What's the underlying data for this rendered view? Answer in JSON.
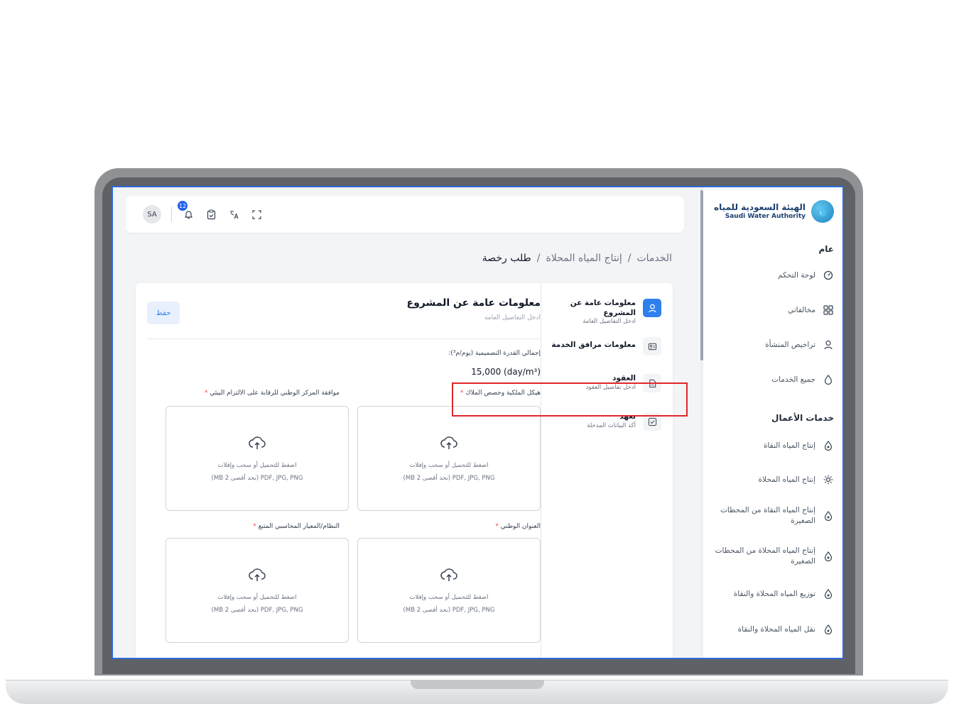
{
  "brand": {
    "name_ar": "الهيئة السعودية للمياه",
    "name_en": "Saudi Water Authority"
  },
  "sidebar": {
    "section_general": "عام",
    "general_items": [
      {
        "label": "لوحة التحكم",
        "icon": "gauge-icon"
      },
      {
        "label": "مخالفاتي",
        "icon": "grid-icon"
      },
      {
        "label": "تراخيص المنشأة",
        "icon": "user-icon"
      },
      {
        "label": "جميع الخدمات",
        "icon": "drop-icon"
      }
    ],
    "section_business": "خدمات الأعمال",
    "business_items": [
      {
        "label": "إنتاج المياه النقاة",
        "icon": "drop-icon"
      },
      {
        "label": "إنتاج المياه المحلاة",
        "icon": "sun-icon"
      },
      {
        "label": "إنتاج المياه النقاة من المحطات الصغيرة",
        "icon": "drop-icon"
      },
      {
        "label": "إنتاج المياه المحلاة من المحطات الصغيرة",
        "icon": "drop-icon"
      },
      {
        "label": "توزيع المياه المحلاة والنقاة",
        "icon": "drop-icon"
      },
      {
        "label": "نقل المياه المحلاة والنقاة",
        "icon": "drop-icon"
      }
    ]
  },
  "topbar": {
    "avatar": "SA",
    "notification_count": "12"
  },
  "breadcrumb": {
    "root": "الخدمات",
    "sep": "/",
    "middle": "إنتاج المياه المحلاة",
    "current": "طلب رخصة"
  },
  "steps": [
    {
      "title": "معلومات عامة عن المشروع",
      "sub": "ادخل التفاصيل العامة",
      "icon": "user-icon",
      "active": true
    },
    {
      "title": "معلومات مرافق الخدمة",
      "sub": "",
      "icon": "id-card-icon",
      "active": false
    },
    {
      "title": "العقود",
      "sub": "ادخل تفاصيل العقود",
      "icon": "document-icon",
      "active": false
    },
    {
      "title": "تعهد",
      "sub": "أكد البيانات المدخلة",
      "icon": "checkbox-icon",
      "active": false
    }
  ],
  "form": {
    "title": "معلومات عامة عن المشروع",
    "subtitle": "ادخل التفاصيل العامة",
    "save_label": "حفظ",
    "capacity_label": "إجمالي القدرة التصميمية (يوم/م³):",
    "capacity_value": "15,000 (day/m³)",
    "required_mark": "*",
    "upload_prompt": "اضغط للتحميل أو سحب وإفلات",
    "upload_formats": "PDF, JPG, PNG (بحد أقصى 2 MB)",
    "fields": [
      {
        "label": "هيكل الملكية وحصص الملاك"
      },
      {
        "label": "موافقة المركز الوطني للرقابة على الالتزام البيئي"
      },
      {
        "label": "العنوان الوطني"
      },
      {
        "label": "النظام/المعيار المحاسبي المتبع"
      }
    ]
  },
  "colors": {
    "accent": "#2f80ed",
    "highlight_box": "#e0262b",
    "screen_border": "#2f6bd8"
  }
}
